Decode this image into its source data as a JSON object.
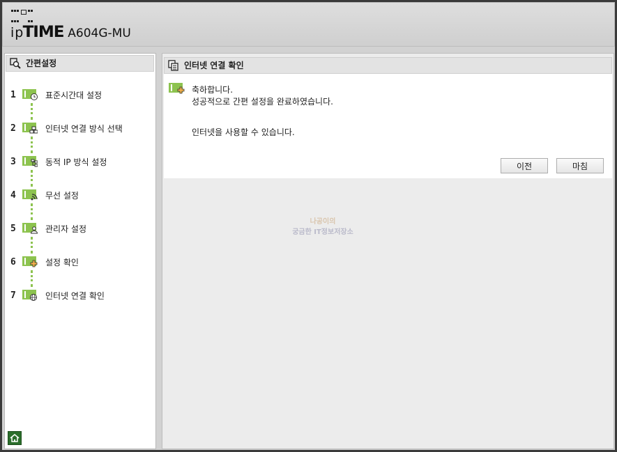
{
  "header": {
    "logo_ip": "ip",
    "logo_time": "TIME",
    "model": "A604G-MU"
  },
  "sidebar": {
    "title": "간편설정",
    "steps": [
      {
        "num": "1",
        "label": "표준시간대 설정",
        "icon": "clock-icon"
      },
      {
        "num": "2",
        "label": "인터넷 연결 방식 선택",
        "icon": "network-icon"
      },
      {
        "num": "3",
        "label": "동적 IP 방식 설정",
        "icon": "ip-tree-icon"
      },
      {
        "num": "4",
        "label": "무선 설정",
        "icon": "wireless-icon"
      },
      {
        "num": "5",
        "label": "관리자 설정",
        "icon": "admin-icon"
      },
      {
        "num": "6",
        "label": "설정 확인",
        "icon": "check-settings-icon"
      },
      {
        "num": "7",
        "label": "인터넷 연결 확인",
        "icon": "globe-icon"
      }
    ]
  },
  "main": {
    "title": "인터넷 연결 확인",
    "line1": "축하합니다.",
    "line2": "성공적으로 간편 설정을 완료하였습니다.",
    "line3": "인터넷을 사용할 수 있습니다.",
    "prev_label": "이전",
    "finish_label": "마침"
  },
  "watermark": {
    "line1": "나공이의",
    "line2": "궁금한 IT정보저장소"
  },
  "colors": {
    "accent_green": "#8dc34f",
    "home_green": "#2b6e2b"
  }
}
